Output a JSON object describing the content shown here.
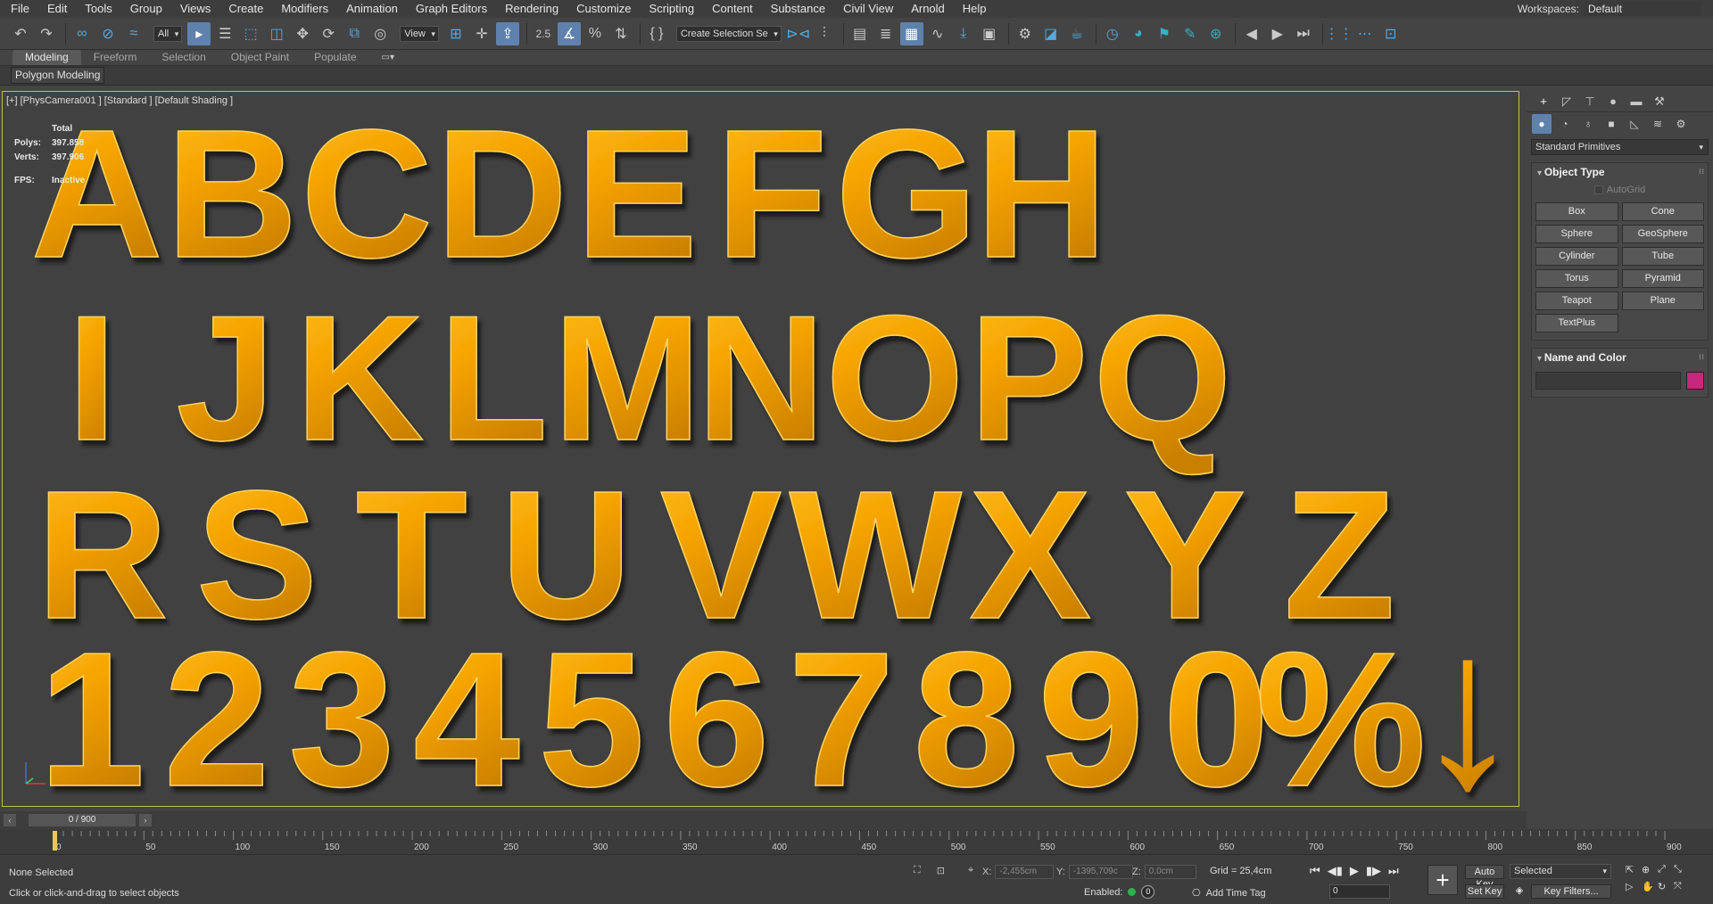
{
  "menu": {
    "items": [
      "File",
      "Edit",
      "Tools",
      "Group",
      "Views",
      "Create",
      "Modifiers",
      "Animation",
      "Graph Editors",
      "Rendering",
      "Customize",
      "Scripting",
      "Content",
      "Substance",
      "Civil View",
      "Arnold",
      "Help"
    ],
    "workspaces_label": "Workspaces:",
    "workspaces_value": "Default"
  },
  "toolbar": {
    "filter_value": "All",
    "ref_coord_value": "View",
    "selection_set_placeholder": "Create Selection Se",
    "snap_value": "2.5"
  },
  "ribbon": {
    "tabs": [
      "Modeling",
      "Freeform",
      "Selection",
      "Object Paint",
      "Populate"
    ],
    "panel_label": "Polygon Modeling"
  },
  "viewport": {
    "label": "[+] [PhysCamera001 ] [Standard ] [Default Shading ]",
    "stats": {
      "total_label": "Total",
      "polys_label": "Polys:",
      "polys_value": "397.858",
      "verts_label": "Verts:",
      "verts_value": "397.906",
      "fps_label": "FPS:",
      "fps_value": "Inactive"
    },
    "rows": [
      [
        "A",
        "B",
        "C",
        "D",
        "E",
        "F",
        "G",
        "H"
      ],
      [
        "I",
        "J",
        "K",
        "L",
        "M",
        "N",
        "O",
        "P",
        "Q"
      ],
      [
        "R",
        "S",
        "T",
        "U",
        "V",
        "W",
        "X",
        "Y",
        "Z"
      ],
      [
        "1",
        "2",
        "3",
        "4",
        "5",
        "6",
        "7",
        "8",
        "9",
        "0",
        "%"
      ]
    ],
    "arrow_glyph": "↓",
    "text_color": "#f5a300"
  },
  "command_panel": {
    "category_value": "Standard Primitives",
    "object_type_title": "Object Type",
    "autogrid_label": "AutoGrid",
    "buttons": [
      "Box",
      "Cone",
      "Sphere",
      "GeoSphere",
      "Cylinder",
      "Tube",
      "Torus",
      "Pyramid",
      "Teapot",
      "Plane",
      "TextPlus"
    ],
    "name_color_title": "Name and Color",
    "swatch_color": "#c5287c"
  },
  "timeline": {
    "frame_counter": "0 / 900",
    "ticks": [
      "0",
      "50",
      "100",
      "150",
      "200",
      "250",
      "300",
      "350",
      "400",
      "450",
      "500",
      "550",
      "600",
      "650",
      "700",
      "750",
      "800",
      "850",
      "900"
    ]
  },
  "status": {
    "selection": "None Selected",
    "prompt": "Click or click-and-drag to select objects",
    "x_label": "X:",
    "x_value": "-2,455cm",
    "y_label": "Y:",
    "y_value": "-1395,709c",
    "z_label": "Z:",
    "z_value": "0,0cm",
    "grid": "Grid = 25,4cm",
    "enabled_label": "Enabled:",
    "enabled_count": "0",
    "add_time_tag": "Add Time Tag",
    "frame_value": "0",
    "auto_key": "Auto Key",
    "set_key": "Set Key",
    "key_mode_value": "Selected",
    "key_filters": "Key Filters..."
  }
}
